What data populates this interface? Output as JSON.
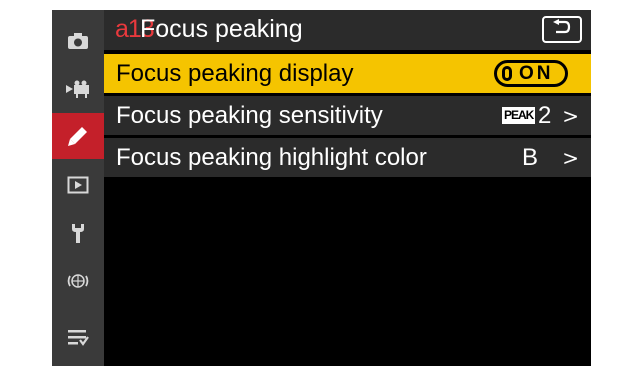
{
  "sidebar": {
    "items": [
      {
        "icon": "camera-icon"
      },
      {
        "icon": "movie-camera-icon"
      },
      {
        "icon": "pencil-icon",
        "active": true
      },
      {
        "icon": "playback-icon"
      },
      {
        "icon": "wrench-icon"
      },
      {
        "icon": "network-icon"
      },
      {
        "icon": "my-menu-icon"
      }
    ]
  },
  "header": {
    "code": "a13",
    "title": "Focus peaking",
    "back_icon": "back-arrow-icon"
  },
  "rows": [
    {
      "label": "Focus peaking display",
      "value": "ON"
    },
    {
      "label": "Focus peaking sensitivity",
      "badge": "PEAK",
      "value": "2",
      "chevron": ">"
    },
    {
      "label": "Focus peaking highlight color",
      "value": "B",
      "chevron": ">"
    }
  ],
  "colors": {
    "accent_selected": "#f5c400",
    "active_tab": "#c4202a",
    "menu_code": "#e8393d",
    "row_background": "#2b2b2b",
    "sidebar_background": "#3a3a3a"
  }
}
